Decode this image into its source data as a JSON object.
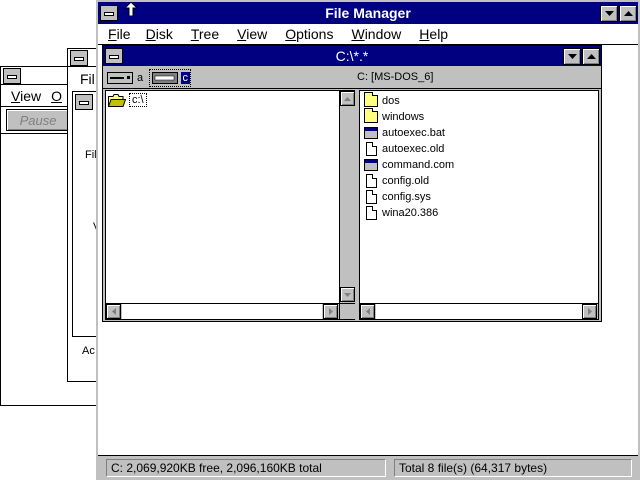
{
  "bg_window_1": {
    "menu": [
      {
        "key": "V",
        "rest": "iew"
      },
      {
        "key": "O",
        "rest": ""
      }
    ],
    "button_label": "Pause"
  },
  "bg_window_2": {
    "menu_partial": "Fil",
    "text_1": "Fil",
    "text_2": "V",
    "text_3": "Ac"
  },
  "file_manager": {
    "title": "File Manager",
    "menu": [
      {
        "key": "F",
        "rest": "ile"
      },
      {
        "key": "D",
        "rest": "isk"
      },
      {
        "key": "T",
        "rest": "ree"
      },
      {
        "key": "V",
        "rest": "iew"
      },
      {
        "key": "O",
        "rest": "ptions"
      },
      {
        "key": "W",
        "rest": "indow"
      },
      {
        "key": "H",
        "rest": "elp"
      }
    ],
    "dir_window": {
      "title": "C:\\*.*",
      "drives": [
        {
          "letter": "a",
          "selected": false,
          "icon": "floppy-drive-icon"
        },
        {
          "letter": "c",
          "selected": true,
          "icon": "hard-drive-icon"
        }
      ],
      "volume_label": "C: [MS-DOS_6]",
      "tree": [
        {
          "label": "c:\\",
          "icon": "open-folder-icon"
        }
      ],
      "files": [
        {
          "name": "dos",
          "type": "folder"
        },
        {
          "name": "windows",
          "type": "folder"
        },
        {
          "name": "autoexec.bat",
          "type": "program"
        },
        {
          "name": "autoexec.old",
          "type": "document"
        },
        {
          "name": "command.com",
          "type": "program"
        },
        {
          "name": "config.old",
          "type": "document"
        },
        {
          "name": "config.sys",
          "type": "document"
        },
        {
          "name": "wina20.386",
          "type": "document"
        }
      ]
    },
    "status": {
      "disk_info": "C: 2,069,920KB free,  2,096,160KB total",
      "file_info": "Total 8 file(s) (64,317 bytes)"
    }
  },
  "colors": {
    "title_active": "#000080",
    "face": "#c0c0c0",
    "selection": "#000080"
  }
}
